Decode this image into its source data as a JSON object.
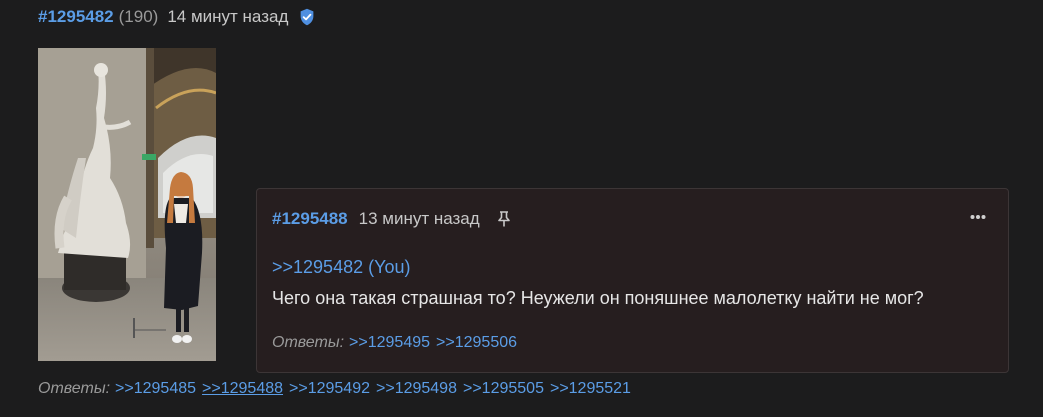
{
  "post": {
    "number": "#1295482",
    "reply_count": "(190)",
    "time": "14 минут назад",
    "verified_icon": "verified-check-icon",
    "replies_label": "Ответы:",
    "replies": [
      ">>1295485",
      ">>1295488 ",
      ">>1295492",
      ">>1295498",
      ">>1295505",
      ">>1295521"
    ]
  },
  "popup": {
    "number": "#1295488",
    "time": "13 минут назад",
    "pin_icon": "pin-icon",
    "menu_icon": "more-dots-icon",
    "quote": ">>1295482 (You)",
    "body": "Чего она такая страшная то? Неужели он поняшнее малолетку найти не мог?",
    "replies_label": "Ответы:",
    "replies": [
      ">>1295495",
      ">>1295506"
    ]
  },
  "colors": {
    "background": "#1c1c1d",
    "link": "#5b9de6",
    "popup_bg": "#261e1f"
  }
}
